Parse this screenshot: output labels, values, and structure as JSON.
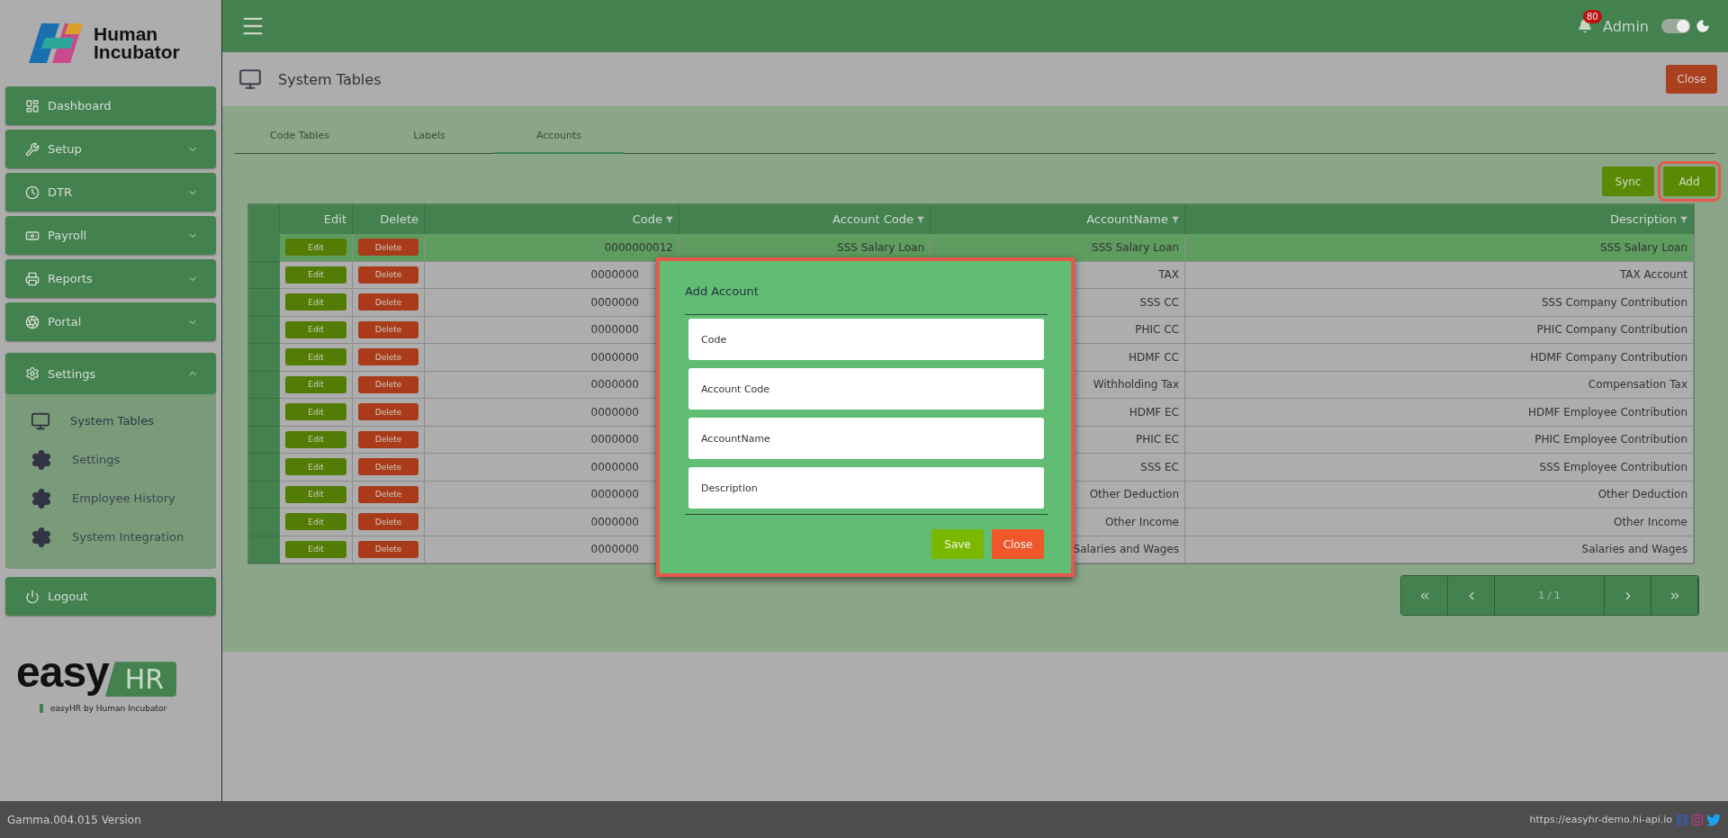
{
  "brand": {
    "name": "Human Incubator"
  },
  "sidebar": {
    "items": [
      {
        "label": "Dashboard",
        "kind": "link"
      },
      {
        "label": "Setup",
        "kind": "group",
        "expanded": false
      },
      {
        "label": "DTR",
        "kind": "group",
        "expanded": false
      },
      {
        "label": "Payroll",
        "kind": "group",
        "expanded": false
      },
      {
        "label": "Reports",
        "kind": "group",
        "expanded": false
      },
      {
        "label": "Portal",
        "kind": "group",
        "expanded": false
      },
      {
        "label": "Settings",
        "kind": "group",
        "expanded": true,
        "children": [
          {
            "label": "System Tables",
            "selected": true
          },
          {
            "label": "Settings",
            "selected": false
          },
          {
            "label": "Employee History",
            "selected": false
          },
          {
            "label": "System Integration",
            "selected": false
          }
        ]
      },
      {
        "label": "Logout",
        "kind": "link"
      }
    ]
  },
  "footer_logo": {
    "word": "easy",
    "badge": "HR",
    "caption": "easyHR by Human Incubator"
  },
  "topbar": {
    "notifications": "80",
    "user": "Admin",
    "dark_mode": {
      "on": true
    }
  },
  "page": {
    "title": "System Tables",
    "close": "Close"
  },
  "tabs": [
    {
      "label": "Code Tables",
      "selected": false
    },
    {
      "label": "Labels",
      "selected": false
    },
    {
      "label": "Accounts",
      "selected": true
    }
  ],
  "actions": [
    "Sync",
    "Add"
  ],
  "table": {
    "columns": [
      "Edit",
      "Delete",
      "Code",
      "Account Code",
      "AccountName",
      "Description"
    ],
    "rows": [
      {
        "selected": true,
        "edit": "Edit",
        "delete": "Delete",
        "code": "0000000012",
        "account_code": "SSS Salary Loan",
        "account_name": "SSS Salary Loan",
        "description": "SSS Salary Loan"
      },
      {
        "selected": false,
        "edit": "Edit",
        "delete": "Delete",
        "code": "0000000",
        "account_name": "TAX",
        "description": "TAX Account"
      },
      {
        "selected": false,
        "edit": "Edit",
        "delete": "Delete",
        "code": "0000000",
        "account_name": "SSS CC",
        "description": "SSS Company Contribution"
      },
      {
        "selected": false,
        "edit": "Edit",
        "delete": "Delete",
        "code": "0000000",
        "account_name": "PHIC CC",
        "description": "PHIC Company Contribution"
      },
      {
        "selected": false,
        "edit": "Edit",
        "delete": "Delete",
        "code": "0000000",
        "account_name": "HDMF CC",
        "description": "HDMF Company Contribution"
      },
      {
        "selected": false,
        "edit": "Edit",
        "delete": "Delete",
        "code": "0000000",
        "account_name": "Withholding Tax",
        "description": "Compensation Tax"
      },
      {
        "selected": false,
        "edit": "Edit",
        "delete": "Delete",
        "code": "0000000",
        "account_name": "HDMF EC",
        "description": "HDMF Employee Contribution"
      },
      {
        "selected": false,
        "edit": "Edit",
        "delete": "Delete",
        "code": "0000000",
        "account_name": "PHIC EC",
        "description": "PHIC Employee Contribution"
      },
      {
        "selected": false,
        "edit": "Edit",
        "delete": "Delete",
        "code": "0000000",
        "account_name": "SSS EC",
        "description": "SSS Employee Contribution"
      },
      {
        "selected": false,
        "edit": "Edit",
        "delete": "Delete",
        "code": "0000000",
        "account_name": "Other Deduction",
        "description": "Other Deduction"
      },
      {
        "selected": false,
        "edit": "Edit",
        "delete": "Delete",
        "code": "0000000",
        "account_name": "Other Income",
        "description": "Other Income"
      },
      {
        "selected": false,
        "edit": "Edit",
        "delete": "Delete",
        "code": "0000000",
        "account_name": "Salaries and Wages",
        "description": "Salaries and Wages"
      }
    ]
  },
  "pagination": {
    "page": "1 / 1"
  },
  "modal": {
    "title": "Add Account",
    "fields": [
      {
        "placeholder": "Code"
      },
      {
        "placeholder": "Account Code"
      },
      {
        "placeholder": "AccountName"
      },
      {
        "placeholder": "Description"
      }
    ],
    "save": "Save",
    "close": "Close"
  },
  "status_bar": {
    "version": "Gamma.004.015 Version",
    "url": "https://easyhr-demo.hi-api.io"
  }
}
